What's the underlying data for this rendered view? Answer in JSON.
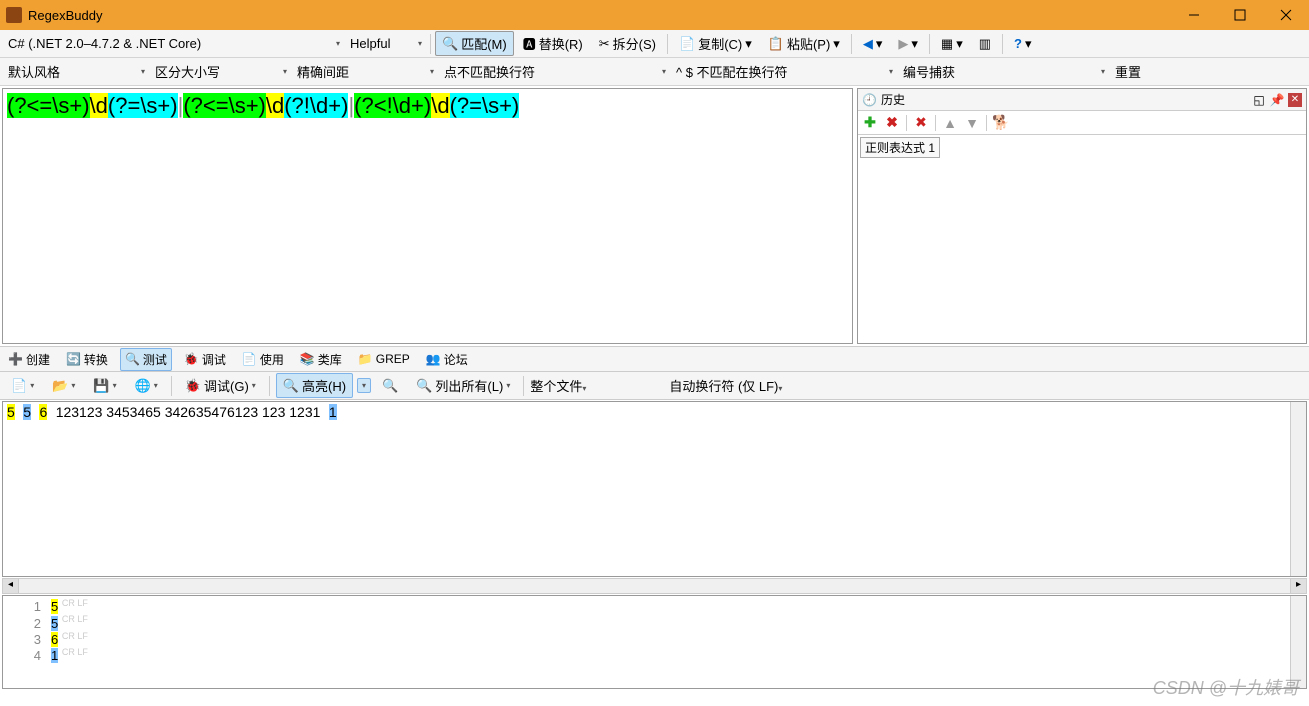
{
  "app": {
    "title": "RegexBuddy"
  },
  "toolbar1": {
    "flavor": "C# (.NET 2.0–4.7.2 & .NET Core)",
    "mode": "Helpful",
    "match": "匹配(M)",
    "replace": "替换(R)",
    "split": "拆分(S)",
    "copy": "复制(C)",
    "paste": "粘贴(P)"
  },
  "toolbar2": {
    "style": "默认风格",
    "case": "区分大小写",
    "spacing": "精确间距",
    "dot": "点不匹配换行符",
    "anchor": "^ $ 不匹配在换行符",
    "numbering": "编号捕获",
    "reset": "重置"
  },
  "regex": {
    "p1_a": "(?<=\\s+)",
    "p1_b": "\\d",
    "p1_c": "(?=\\s+)",
    "alt1": "|",
    "p2_a": "(?<=\\s+)",
    "p2_b": "\\d",
    "p2_c": "(?!\\d+)",
    "alt2": "|",
    "p3_a": "(?<!\\d+)",
    "p3_b": "\\d",
    "p3_c": "(?=\\s+)"
  },
  "history": {
    "title": "历史",
    "item1": "正则表达式 1"
  },
  "tabs": {
    "create": "创建",
    "convert": "转换",
    "test": "测试",
    "debug": "调试",
    "use": "使用",
    "library": "类库",
    "grep": "GREP",
    "forum": "论坛"
  },
  "testbar": {
    "debug": "调试(G)",
    "highlight": "高亮(H)",
    "listall": "列出所有(L)",
    "scope": "整个文件",
    "linebreak": "自动换行符 (仅 LF)"
  },
  "test_text": {
    "prefix": [
      "5",
      "5",
      "6"
    ],
    "body": "123123 3453465 342635476123 123 1231",
    "suffix": "1"
  },
  "results": {
    "rows": [
      {
        "n": "1",
        "v": "5",
        "cls": "hl-y"
      },
      {
        "n": "2",
        "v": "5",
        "cls": "hl-b"
      },
      {
        "n": "3",
        "v": "6",
        "cls": "hl-y"
      },
      {
        "n": "4",
        "v": "1",
        "cls": "hl-b"
      }
    ]
  },
  "watermark": "CSDN @十九婊哥"
}
